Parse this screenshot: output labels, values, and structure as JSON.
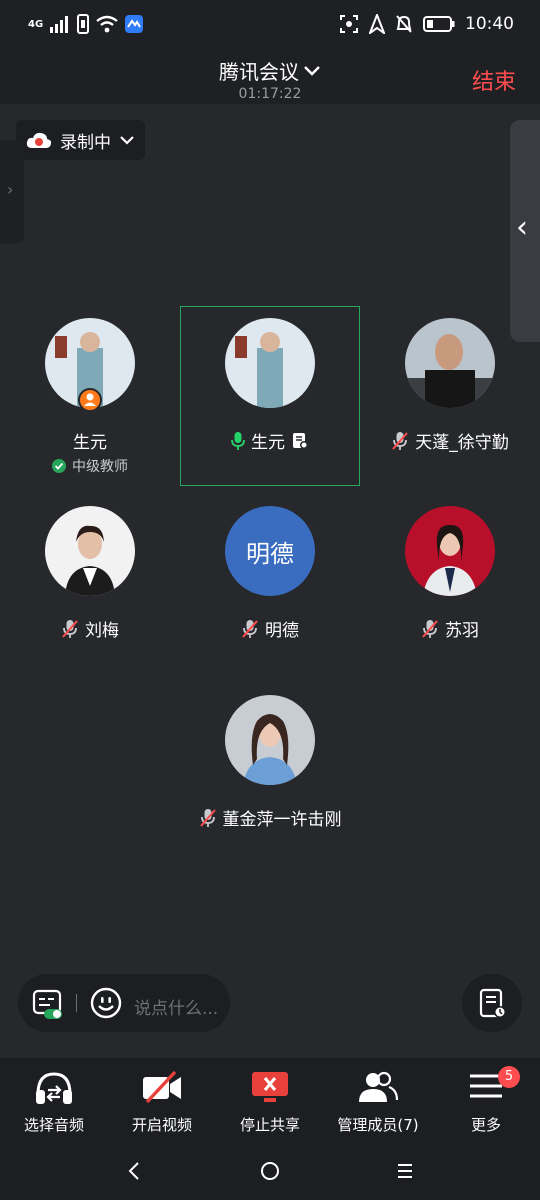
{
  "status_bar": {
    "network": "4G",
    "time": "10:40"
  },
  "header": {
    "title": "腾讯会议",
    "timer": "01:17:22",
    "end_label": "结束"
  },
  "recording": {
    "label": "录制中"
  },
  "participants": [
    {
      "name": "生元",
      "role": "中级教师"
    },
    {
      "name": "生元"
    },
    {
      "name": "天蓬_徐守勤"
    },
    {
      "name": "刘梅"
    },
    {
      "name": "明德",
      "avatar_text": "明德"
    },
    {
      "name": "苏羽"
    },
    {
      "name": "董金萍一许击刚"
    }
  ],
  "chat": {
    "placeholder": "说点什么..."
  },
  "toolbar": {
    "audio": "选择音频",
    "video": "开启视频",
    "share": "停止共享",
    "members": "管理成员(7)",
    "more": "更多",
    "more_badge": "5"
  },
  "colors": {
    "accent_green": "#26a65b",
    "end_red": "#ff4d4f",
    "host_orange": "#ff7a1a",
    "avatar_blue": "#3a6dbf"
  }
}
